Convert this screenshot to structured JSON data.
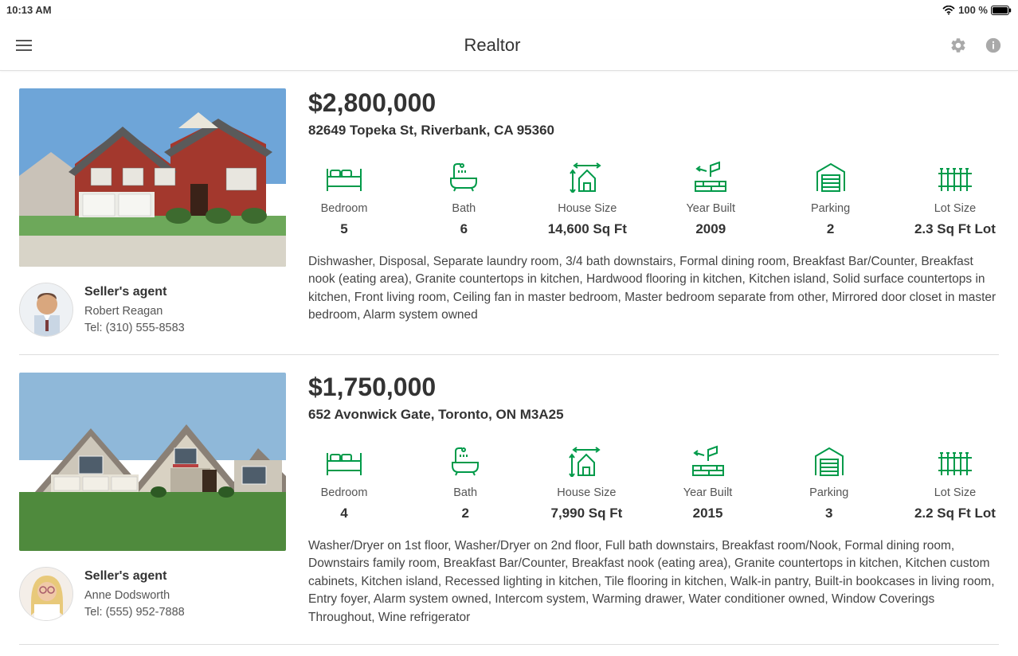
{
  "status_bar": {
    "time": "10:13 AM",
    "battery": "100 %"
  },
  "app_bar": {
    "title": "Realtor"
  },
  "stat_labels": {
    "bedroom": "Bedroom",
    "bath": "Bath",
    "house_size": "House Size",
    "year_built": "Year Built",
    "parking": "Parking",
    "lot_size": "Lot Size"
  },
  "agent_role_label": "Seller's agent",
  "listings": [
    {
      "price": "$2,800,000",
      "address": "82649 Topeka St, Riverbank, CA 95360",
      "stats": {
        "bedroom": "5",
        "bath": "6",
        "house_size": "14,600 Sq Ft",
        "year_built": "2009",
        "parking": "2",
        "lot_size": "2.3 Sq Ft Lot"
      },
      "description": "Dishwasher, Disposal, Separate laundry room, 3/4 bath downstairs, Formal dining room, Breakfast Bar/Counter, Breakfast nook (eating area), Granite countertops in kitchen, Hardwood flooring in kitchen, Kitchen island, Solid surface countertops in kitchen, Front living room, Ceiling fan in master bedroom, Master bedroom separate from other, Mirrored door closet in master bedroom, Alarm system owned",
      "agent": {
        "name": "Robert Reagan",
        "tel": "Tel: (310) 555-8583"
      }
    },
    {
      "price": "$1,750,000",
      "address": "652 Avonwick Gate, Toronto, ON M3A25",
      "stats": {
        "bedroom": "4",
        "bath": "2",
        "house_size": "7,990 Sq Ft",
        "year_built": "2015",
        "parking": "3",
        "lot_size": "2.2 Sq Ft Lot"
      },
      "description": "Washer/Dryer on 1st floor, Washer/Dryer on 2nd floor, Full bath downstairs, Breakfast room/Nook, Formal dining room, Downstairs family room, Breakfast Bar/Counter, Breakfast nook (eating area), Granite countertops in kitchen, Kitchen custom cabinets, Kitchen island, Recessed lighting in kitchen, Tile flooring in kitchen, Walk-in pantry, Built-in bookcases in living room, Entry foyer, Alarm system owned, Intercom system, Warming drawer, Water conditioner owned, Window Coverings Throughout, Wine refrigerator",
      "agent": {
        "name": "Anne Dodsworth",
        "tel": "Tel: (555) 952-7888"
      }
    }
  ]
}
